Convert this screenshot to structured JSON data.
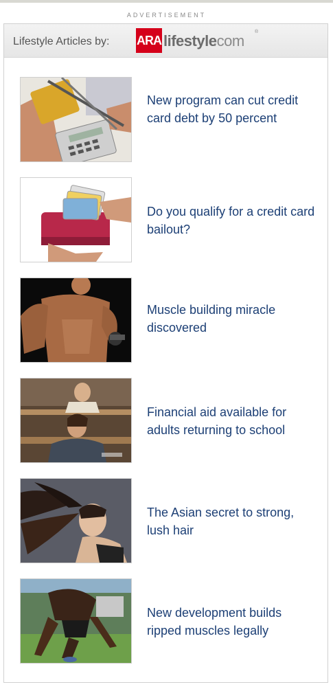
{
  "ad_label": "ADVERTISEMENT",
  "header": {
    "text": "Lifestyle Articles by:",
    "logo": {
      "box": "ARA",
      "word": "lifestyle",
      "suffix": ".com",
      "reg": "®"
    }
  },
  "articles": [
    {
      "title": "New program can cut credit card debt by 50 percent",
      "image": "scissors-cutting-credit-card-calculator"
    },
    {
      "title": "Do you qualify for a credit card bailout?",
      "image": "wallet-full-of-credit-cards"
    },
    {
      "title": "Muscle building miracle discovered",
      "image": "bodybuilder-lifting-dumbbell"
    },
    {
      "title": "Financial aid available for adults returning to school",
      "image": "adult-student-in-classroom"
    },
    {
      "title": "The Asian secret to strong, lush hair",
      "image": "woman-with-flowing-hair"
    },
    {
      "title": "New development builds ripped muscles legally",
      "image": "athlete-sprint-start"
    }
  ],
  "colors": {
    "link": "#1c3f75",
    "brand_red": "#d5001a",
    "header_text": "#555555"
  }
}
